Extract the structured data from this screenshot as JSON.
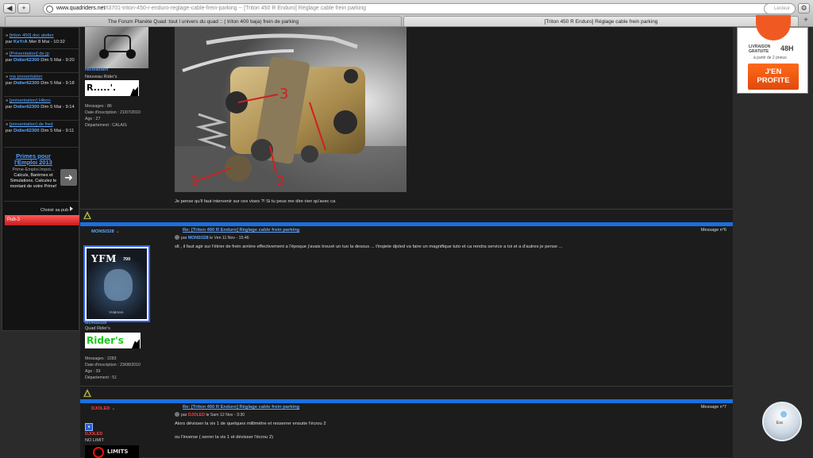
{
  "browser": {
    "back_label": "◀",
    "forward_label": "+",
    "url_host": "www.quadriders.net",
    "url_rest": "/t3701-triton-450-r-enduro-reglage-cable-frein-parking -- [Triton 450 R Enduro] Réglage cable frein parking",
    "search_placeholder": "Lecteur",
    "tab1": "The Forum Planète Quad :tout l univers du quad :: ( triton 400 baja) frein de parking",
    "tab2": "[Triton 450 R Enduro] Réglage cable frein parking",
    "new_tab": "+"
  },
  "sidebar": {
    "recent": [
      {
        "title": "[triton 450] doc atelier",
        "by": "par",
        "user": "KeYrA",
        "date": "Mer 8 Mai - 10:32"
      },
      {
        "title": "[Présentation] de jp",
        "by": "par",
        "user": "Didier62300",
        "date": "Dim 5 Mai - 9:20"
      },
      {
        "title": "ma presentation",
        "by": "par",
        "user": "Didier62300",
        "date": "Dim 5 Mai - 9:18"
      },
      {
        "title": "[présentation] Hiboo",
        "by": "par",
        "user": "Didier62300",
        "date": "Dim 5 Mai - 9:14"
      },
      {
        "title": "[presentation] de fred",
        "by": "par",
        "user": "Didier62300",
        "date": "Dim 5 Mai - 9:11"
      }
    ],
    "promo": {
      "title": "Primes pour l'Emploi 2013",
      "site": "Prime-Emploi.Impot...",
      "desc": "Calculs, Barèmes et Simulations. Calculez le montant de votre Prime!"
    },
    "choose_pub": "Choisir sa pub",
    "pub_label": "Pub-3"
  },
  "post1": {
    "user": "Nicolasden",
    "rank": "Nouveau Rider's",
    "badge": "R.....'.",
    "messages": "Messages : 86",
    "inscription": "Date d'inscription : 21/07/2010",
    "age": "Age : 27",
    "departement": "Département : CALAIS",
    "body": "Je pense qu'il faut intervenir sur ces vises ?! Si tu peux me dire rien qu'avec ca",
    "photo_labels": [
      "1",
      "2",
      "3"
    ]
  },
  "post2": {
    "user": "MONSI328",
    "msg_no": "Message n°6",
    "title": "Re: [Triton 450 R Enduro] Réglage cable frein parking",
    "meta_by": "par",
    "meta_user": "MONSI328",
    "meta_date": "le Ven 11 Nov - 15:46",
    "body": "slt , il faut agir sur l'étrier de frein arrière effectivement a l'époque j'avais trouvé un tuo la dessus ... t'inqiete djoled va faire un magnifique tuto et ca rendra service a toi et a d'autres je pense ...",
    "avatar_text": "YFM",
    "avatar_sub": "700",
    "avatar_brand": "YAMAHA",
    "user_label": "MONSI328",
    "rank": "Quad Rider's",
    "badge": "Rider's",
    "messages": "Messages : 2283",
    "inscription": "Date d'inscription : 23/08/2010",
    "age": "Age : 39",
    "departement": "Département : 51"
  },
  "post3": {
    "user": "DJOLED",
    "msg_no": "Message n°7",
    "title": "Re: [Triton 450 R Enduro] Réglage cable frein parking",
    "meta_by": "par",
    "meta_user": "DJOLED",
    "meta_date": "le Sam 12 Nov - 3:30",
    "body_line1": "Alors dévisser la vis 1 de quelques millimètre et resserrer ensuite l'écrou 2",
    "body_line2": "ou l'inverse ( serrer la vis 1 et dévisser l'écrou 2)",
    "user_label": "DJOLED",
    "rank": "NO LIMIT",
    "quote_icon": "♦",
    "avatar_text": "LIMITS"
  },
  "ad": {
    "livraison": "LIVRAISON GRATUITE",
    "hours": "48H",
    "apartir": "à partir de 2 pneus",
    "cta": "J'EN PROFITE"
  },
  "widget": {
    "esc": "Esc"
  }
}
